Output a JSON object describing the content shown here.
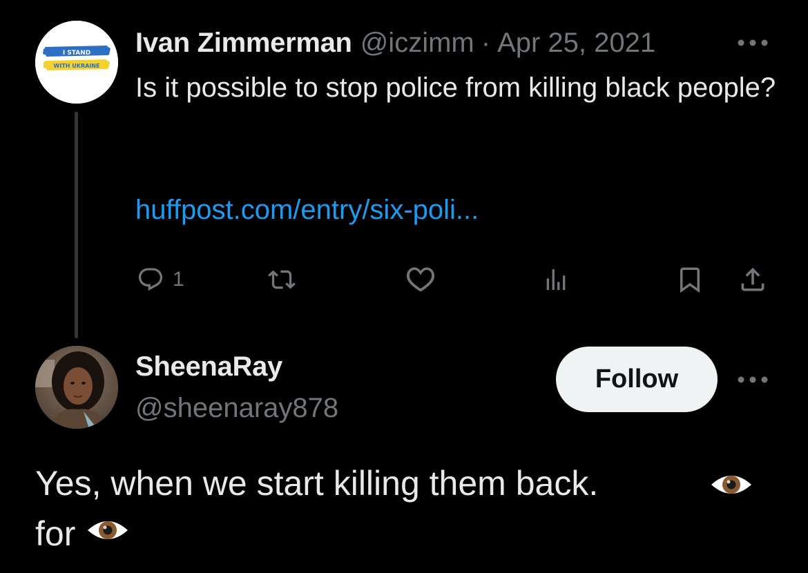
{
  "parent_tweet": {
    "avatar": {
      "line1": "I STAND",
      "line2": "WITH UKRAINE",
      "flag_blue": "#2d6fc2",
      "flag_yellow": "#f5d130"
    },
    "author_name": "Ivan Zimmerman",
    "author_handle": "@iczimm",
    "separator": "·",
    "date": "Apr 25, 2021",
    "text": "Is it possible to stop police from killing black people?",
    "link": "huffpost.com/entry/six-poli...",
    "actions": {
      "reply_icon": "reply-icon",
      "reply_count": "1",
      "retweet_icon": "retweet-icon",
      "like_icon": "heart-icon",
      "views_icon": "views-icon",
      "bookmark_icon": "bookmark-icon",
      "share_icon": "share-icon"
    },
    "more_icon": "more-icon"
  },
  "reply": {
    "author_name": "SheenaRay",
    "author_handle": "@sheenaray878",
    "follow_label": "Follow",
    "text_line1": "Yes, when we start killing them back.",
    "text_line2": "for",
    "emoji_icon": "eye-icon",
    "more_icon": "more-icon"
  },
  "colors": {
    "background": "#000000",
    "primary_text": "#e7e9ea",
    "secondary_text": "#71767b",
    "link": "#1d9bf0",
    "follow_button_bg": "#eff3f4",
    "follow_button_text": "#0f1419"
  }
}
